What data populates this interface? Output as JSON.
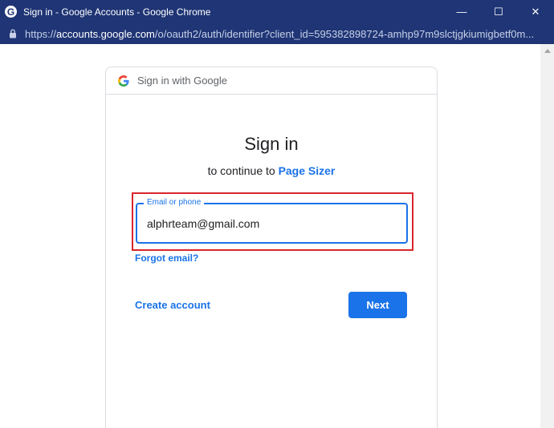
{
  "window": {
    "title": "Sign in - Google Accounts - Google Chrome",
    "favicon": "G",
    "minimize_glyph": "—",
    "maximize_glyph": "☐",
    "close_glyph": "✕"
  },
  "address_bar": {
    "scheme": "https://",
    "host": "accounts.google.com",
    "path": "/o/oauth2/auth/identifier?client_id=595382898724-amhp97m9slctjgkiumigbetf0m..."
  },
  "card": {
    "header_text": "Sign in with Google",
    "title": "Sign in",
    "subtitle_prefix": "to continue to ",
    "app_name": "Page Sizer"
  },
  "email_field": {
    "label": "Email or phone",
    "value": "alphrteam@gmail.com"
  },
  "links": {
    "forgot_email": "Forgot email?",
    "create_account": "Create account"
  },
  "buttons": {
    "next": "Next"
  },
  "colors": {
    "titlebar": "#1f3575",
    "accent": "#1a73e8",
    "highlight": "#d9262c"
  },
  "icons": {
    "lock": "lock-icon",
    "google_logo": "google-logo-icon",
    "scroll_up": "scroll-up-arrow-icon"
  }
}
